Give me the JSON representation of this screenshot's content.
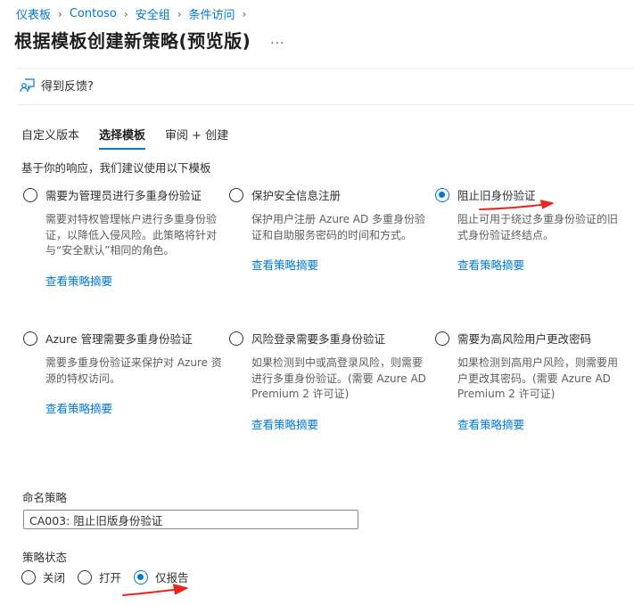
{
  "breadcrumb": [
    "仪表板",
    "Contoso",
    "安全组",
    "条件访问"
  ],
  "page": {
    "title": "根据模板创建新策略(预览版)",
    "more_label": "..."
  },
  "feedback": {
    "label": "得到反馈?"
  },
  "tabs": [
    {
      "label": "自定义版本",
      "active": false
    },
    {
      "label": "选择模板",
      "active": true
    },
    {
      "label": "审阅 + 创建",
      "active": false
    }
  ],
  "suggestion_text": "基于你的响应，我们建议使用以下模板",
  "templates": [
    {
      "title": "需要为管理员进行多重身份验证",
      "description": "需要对特权管理帐户进行多重身份验证，以降低入侵风险。此策略将针对与“安全默认”相同的角色。",
      "link": "查看策略摘要",
      "selected": false
    },
    {
      "title": "保护安全信息注册",
      "description": "保护用户注册 Azure AD 多重身份验证和自助服务密码的时间和方式。",
      "link": "查看策略摘要",
      "selected": false
    },
    {
      "title": "阻止旧身份验证",
      "description": "阻止可用于绕过多重身份验证的旧式身份验证终结点。",
      "link": "查看策略摘要",
      "selected": true
    },
    {
      "title": "Azure 管理需要多重身份验证",
      "description": "需要多重身份验证来保护对 Azure 资源的特权访问。",
      "link": "查看策略摘要",
      "selected": false
    },
    {
      "title": "风险登录需要多重身份验证",
      "description": "如果检测到中或高登录风险，则需要进行多重身份验证。(需要 Azure AD Premium 2 许可证)",
      "link": "查看策略摘要",
      "selected": false
    },
    {
      "title": "需要为高风险用户更改密码",
      "description": "如果检测到高用户风险，则需要用户更改其密码。(需要 Azure AD Premium 2 许可证)",
      "link": "查看策略摘要",
      "selected": false
    }
  ],
  "policy_name": {
    "label": "命名策略",
    "value": "CA003: 阻止旧版身份验证"
  },
  "policy_state": {
    "label": "策略状态",
    "options": [
      {
        "label": "关闭",
        "selected": false
      },
      {
        "label": "打开",
        "selected": false
      },
      {
        "label": "仅报告",
        "selected": true
      }
    ]
  },
  "colors": {
    "accent": "#0078d4",
    "annotation_arrow": "#e8281e"
  },
  "icons": {
    "feedback": "feedback-icon",
    "separator": "chevron-right-icon"
  }
}
